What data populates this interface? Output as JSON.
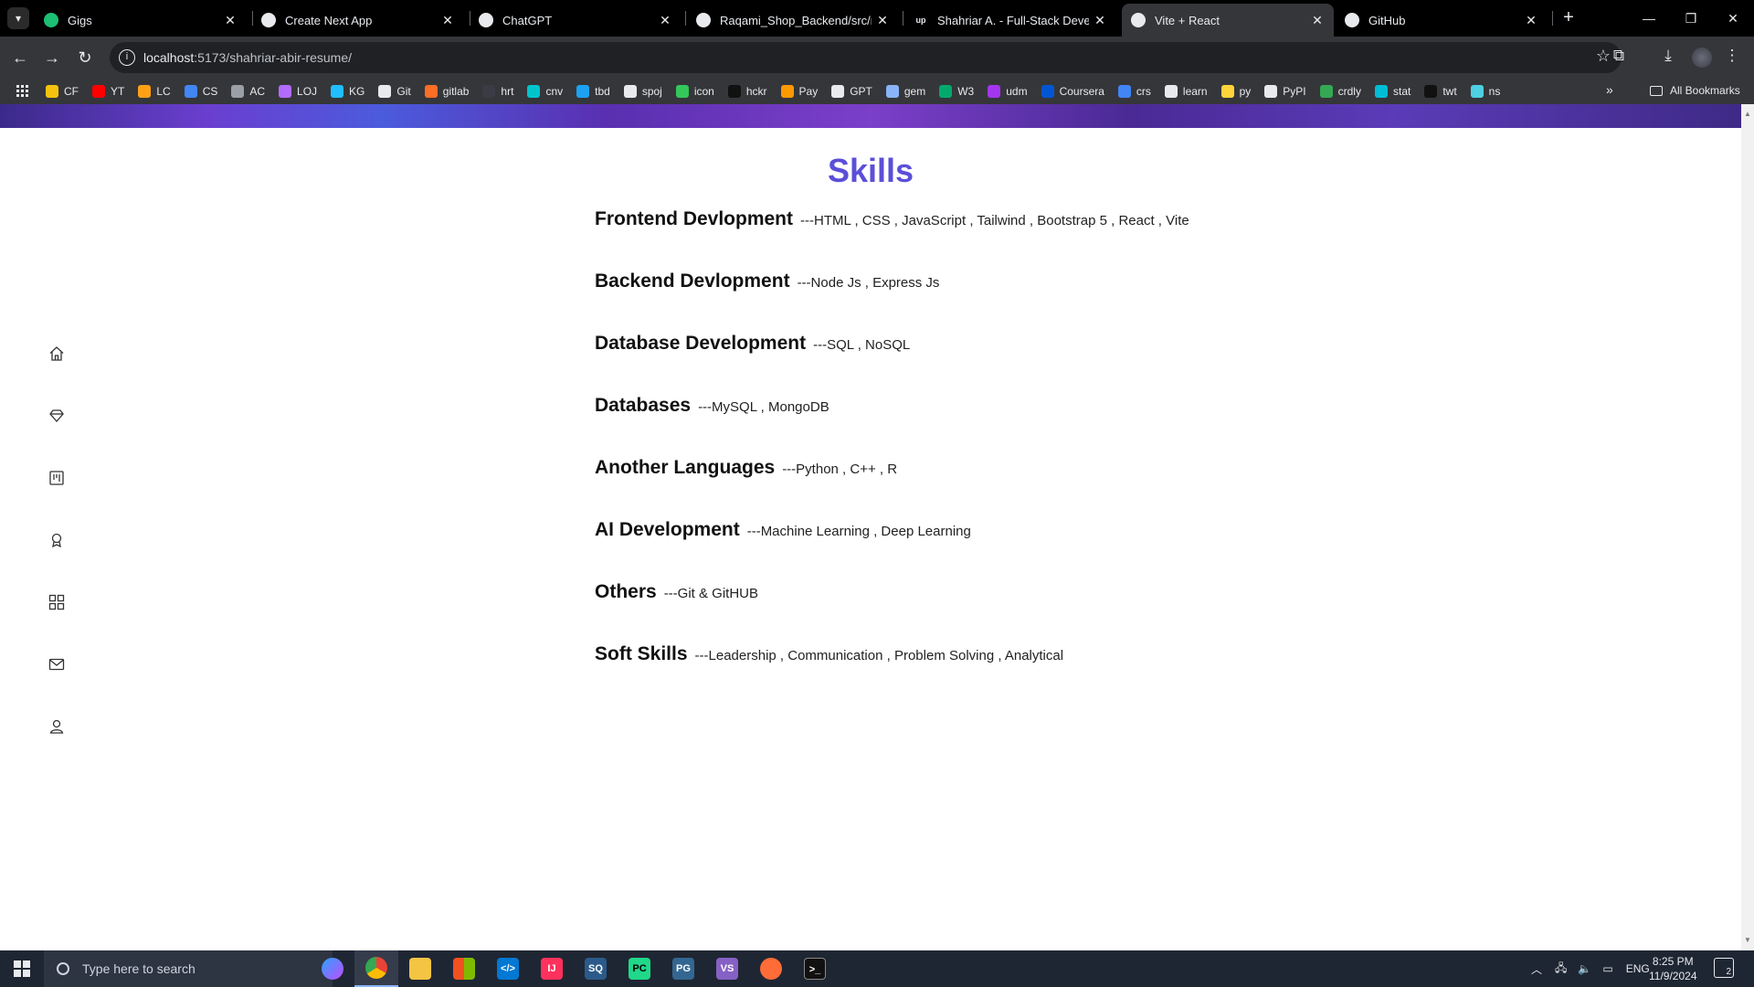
{
  "browser": {
    "tabs": [
      {
        "title": "Gigs",
        "favicon": "fiverr-icon",
        "active": false
      },
      {
        "title": "Create Next App",
        "favicon": "globe-icon",
        "active": false
      },
      {
        "title": "ChatGPT",
        "favicon": "openai-icon",
        "active": false
      },
      {
        "title": "Raqami_Shop_Backend/src/mai",
        "favicon": "github-icon",
        "active": false
      },
      {
        "title": "Shahriar A. - Full-Stack Develop",
        "favicon": "upwork-icon",
        "active": false
      },
      {
        "title": "Vite + React",
        "favicon": "globe-icon",
        "active": true
      },
      {
        "title": "GitHub",
        "favicon": "github-icon",
        "active": false
      }
    ],
    "url_host": "localhost",
    "url_rest": ":5173/shahriar-abir-resume/",
    "bookmarks": [
      {
        "label": "CF",
        "color": "#f4c20d"
      },
      {
        "label": "YT",
        "color": "#ff0000"
      },
      {
        "label": "LC",
        "color": "#ffa116"
      },
      {
        "label": "CS",
        "color": "#4285f4"
      },
      {
        "label": "AC",
        "color": "#9aa0a6"
      },
      {
        "label": "LOJ",
        "color": "#b36bff"
      },
      {
        "label": "KG",
        "color": "#20beff"
      },
      {
        "label": "Git",
        "color": "#e8eaed"
      },
      {
        "label": "gitlab",
        "color": "#fc6d26"
      },
      {
        "label": "hrt",
        "color": "#3a3b45"
      },
      {
        "label": "cnv",
        "color": "#00c4cc"
      },
      {
        "label": "tbd",
        "color": "#1da1f2"
      },
      {
        "label": "spoj",
        "color": "#e8eaed"
      },
      {
        "label": "icon",
        "color": "#34c759"
      },
      {
        "label": "hckr",
        "color": "#111111"
      },
      {
        "label": "Pay",
        "color": "#ff9900"
      },
      {
        "label": "GPT",
        "color": "#e8eaed"
      },
      {
        "label": "gem",
        "color": "#8ab4f8"
      },
      {
        "label": "W3",
        "color": "#04aa6d"
      },
      {
        "label": "udm",
        "color": "#a435f0"
      },
      {
        "label": "Coursera",
        "color": "#0056d2"
      },
      {
        "label": "crs",
        "color": "#4285f4"
      },
      {
        "label": "learn",
        "color": "#e8eaed"
      },
      {
        "label": "py",
        "color": "#ffd43b"
      },
      {
        "label": "PyPI",
        "color": "#e8eaed"
      },
      {
        "label": "crdly",
        "color": "#34a853"
      },
      {
        "label": "stat",
        "color": "#00bcd4"
      },
      {
        "label": "twt",
        "color": "#111111"
      },
      {
        "label": "ns",
        "color": "#4dd0e1"
      }
    ],
    "all_bookmarks_label": "All Bookmarks"
  },
  "page": {
    "section_title": "Skills",
    "title_color": "#5b4fd8",
    "side_nav": [
      "home-icon",
      "diamond-icon",
      "board-icon",
      "award-icon",
      "grid-icon",
      "mail-icon",
      "user-icon"
    ],
    "skills": [
      {
        "name": "Frontend Devlopment",
        "value": "---HTML , CSS , JavaScript , Tailwind , Bootstrap 5 , React , Vite"
      },
      {
        "name": "Backend Devlopment",
        "value": "---Node Js , Express Js"
      },
      {
        "name": "Database Development",
        "value": "---SQL , NoSQL"
      },
      {
        "name": "Databases",
        "value": "---MySQL , MongoDB"
      },
      {
        "name": "Another Languages",
        "value": "---Python , C++ , R"
      },
      {
        "name": "AI Development",
        "value": "---Machine Learning , Deep Learning"
      },
      {
        "name": "Others",
        "value": "---Git & GitHUB"
      },
      {
        "name": "Soft Skills",
        "value": "---Leadership , Communication , Problem Solving , Analytical"
      }
    ]
  },
  "taskbar": {
    "search_placeholder": "Type here to search",
    "language": "ENG",
    "time": "8:25 PM",
    "date": "11/9/2024",
    "notification_count": "2"
  }
}
